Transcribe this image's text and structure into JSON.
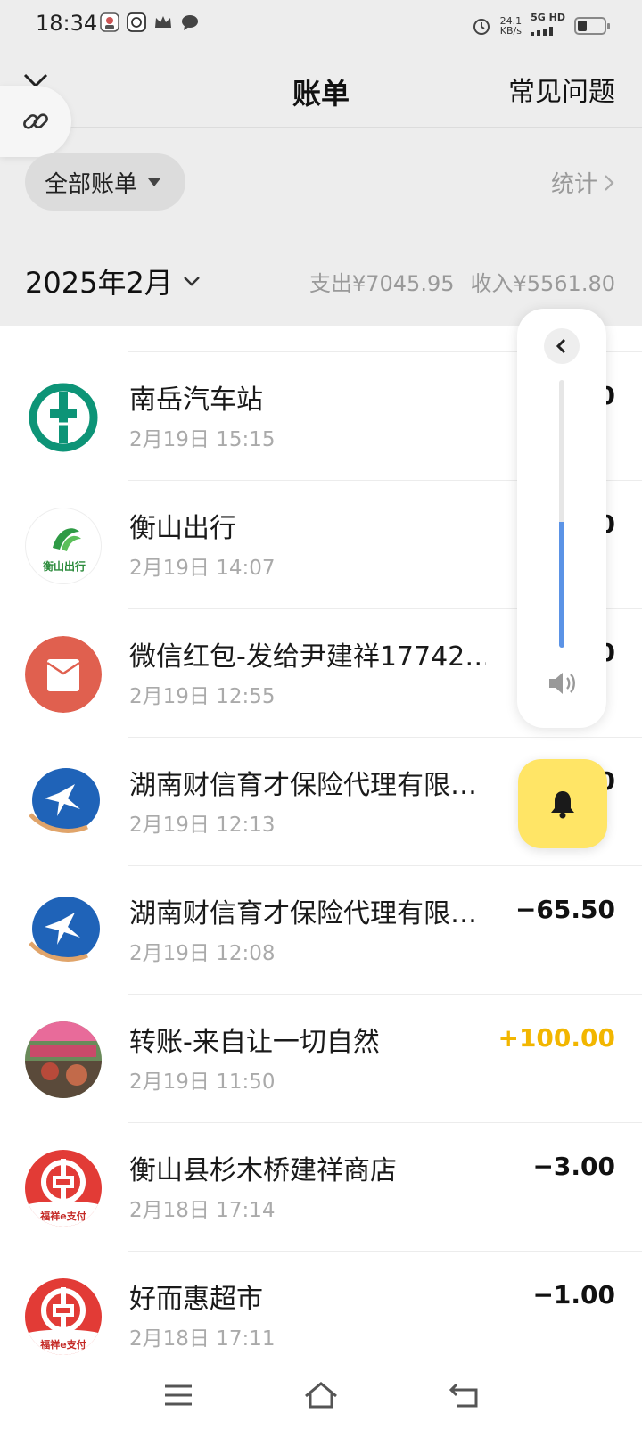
{
  "status_bar": {
    "time": "18:34",
    "net_speed_value": "24.1",
    "net_speed_unit": "KB/s",
    "network_type": "5G HD",
    "icons": [
      "avatar-icon",
      "app-icon",
      "crown-icon",
      "chat-bubble-icon",
      "alarm-icon",
      "signal-icon",
      "battery-icon"
    ]
  },
  "header": {
    "title": "账单",
    "faq_label": "常见问题",
    "close_icon": "close-icon",
    "link_icon": "link-icon"
  },
  "filter": {
    "all_bills_label": "全部账单",
    "stats_label": "统计"
  },
  "month": {
    "label": "2025年2月",
    "expense": "支出¥7045.95",
    "income": "收入¥5561.80"
  },
  "transactions": [
    {
      "name": "南岳汽车站",
      "time": "2月19日 15:15",
      "amount": "0",
      "type": "expense",
      "avatar": "bank-logo"
    },
    {
      "name": "衡山出行",
      "time": "2月19日 14:07",
      "amount": "0",
      "type": "expense",
      "avatar": "hengshan-logo",
      "avatar_text": "衡山出行"
    },
    {
      "name": "微信红包-发给尹建祥17742…",
      "time": "2月19日 12:55",
      "amount": "0",
      "type": "expense",
      "avatar": "red-packet"
    },
    {
      "name": "湖南财信育才保险代理有限…",
      "time": "2月19日 12:13",
      "amount": "0",
      "type": "expense",
      "avatar": "insurance-logo"
    },
    {
      "name": "湖南财信育才保险代理有限…",
      "time": "2月19日 12:08",
      "amount": "−65.50",
      "type": "expense",
      "avatar": "insurance-logo"
    },
    {
      "name": "转账-来自让一切自然",
      "time": "2月19日 11:50",
      "amount": "+100.00",
      "type": "income",
      "avatar": "photo-avatar"
    },
    {
      "name": "衡山县杉木桥建祥商店",
      "time": "2月18日 17:14",
      "amount": "−3.00",
      "type": "expense",
      "avatar": "bank-pay-logo",
      "avatar_text": "福祥e支付"
    },
    {
      "name": "好而惠超市",
      "time": "2月18日 17:11",
      "amount": "−1.00",
      "type": "expense",
      "avatar": "bank-pay-logo",
      "avatar_text": "福祥e支付"
    }
  ],
  "volume": {
    "level_fraction": 0.47,
    "fill_color": "#5b93e6"
  },
  "colors": {
    "income": "#f2b600",
    "bell_fab": "#ffe566",
    "red_packet": "#e0604f",
    "bank_green": "#0d9477",
    "insurance_blue": "#1f63b8"
  }
}
